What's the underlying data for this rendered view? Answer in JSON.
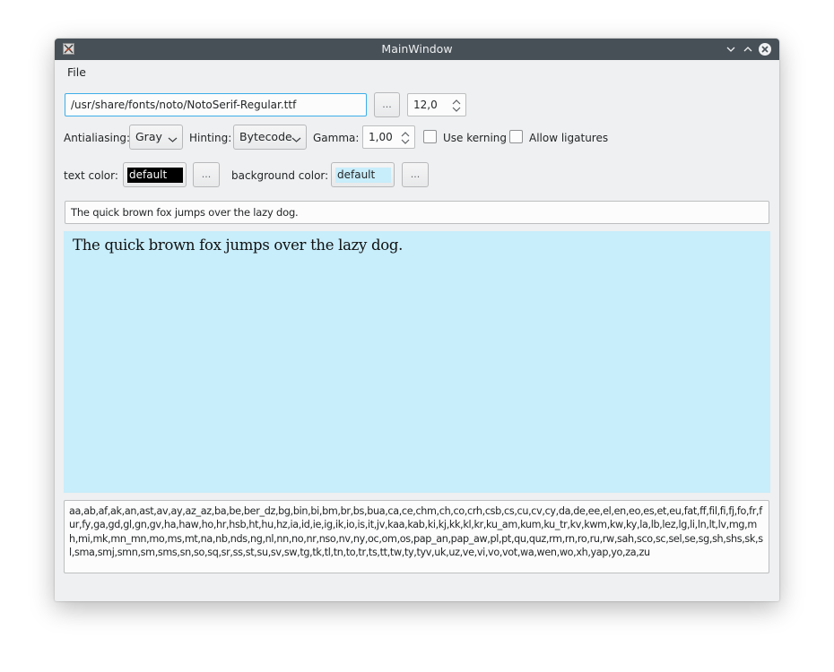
{
  "window": {
    "title": "MainWindow",
    "controls": [
      "minimize-icon",
      "maximize-icon",
      "close-icon"
    ]
  },
  "menubar": {
    "items": [
      {
        "label": "File"
      }
    ]
  },
  "font_row": {
    "font_path": "/usr/share/fonts/noto/NotoSerif-Regular.ttf",
    "browse_label": "...",
    "size": "12,0"
  },
  "options_row": {
    "antialiasing_label": "Antialiasing:",
    "antialiasing_value": "Gray",
    "hinting_label": "Hinting:",
    "hinting_value": "Bytecode",
    "gamma_label": "Gamma:",
    "gamma_value": "1,00",
    "kerning_label": "Use kerning",
    "kerning_checked": false,
    "ligatures_label": "Allow ligatures",
    "ligatures_checked": false
  },
  "color_row": {
    "text_color_label": "text color:",
    "text_color_value": "default",
    "text_color_swatch": "#000000",
    "text_color_fg": "#ffffff",
    "text_browse_label": "...",
    "bg_color_label": "background color:",
    "bg_color_value": "default",
    "bg_color_swatch": "#c8edfb",
    "bg_browse_label": "..."
  },
  "sample_input": {
    "value": "The quick brown fox jumps over the lazy dog."
  },
  "preview": {
    "text": "The quick brown fox jumps over the lazy dog.",
    "background": "#c8edfb"
  },
  "languages": {
    "text": "aa,ab,af,ak,an,ast,av,ay,az_az,ba,be,ber_dz,bg,bin,bi,bm,br,bs,bua,ca,ce,chm,ch,co,crh,csb,cs,cu,cv,cy,da,de,ee,el,en,eo,es,et,eu,fat,ff,fil,fi,fj,fo,fr,fur,fy,ga,gd,gl,gn,gv,ha,haw,ho,hr,hsb,ht,hu,hz,ia,id,ie,ig,ik,io,is,it,jv,kaa,kab,ki,kj,kk,kl,kr,ku_am,kum,ku_tr,kv,kwm,kw,ky,la,lb,lez,lg,li,ln,lt,lv,mg,mh,mi,mk,mn_mn,mo,ms,mt,na,nb,nds,ng,nl,nn,no,nr,nso,nv,ny,oc,om,os,pap_an,pap_aw,pl,pt,qu,quz,rm,rn,ro,ru,rw,sah,sco,sc,sel,se,sg,sh,shs,sk,sl,sma,smj,smn,sm,sms,sn,so,sq,sr,ss,st,su,sv,sw,tg,tk,tl,tn,to,tr,ts,tt,tw,ty,tyv,uk,uz,ve,vi,vo,vot,wa,wen,wo,xh,yap,yo,za,zu"
  },
  "colors": {
    "titlebar": "#475057",
    "window_bg": "#eff0f1",
    "focus_accent": "#3daee9"
  }
}
